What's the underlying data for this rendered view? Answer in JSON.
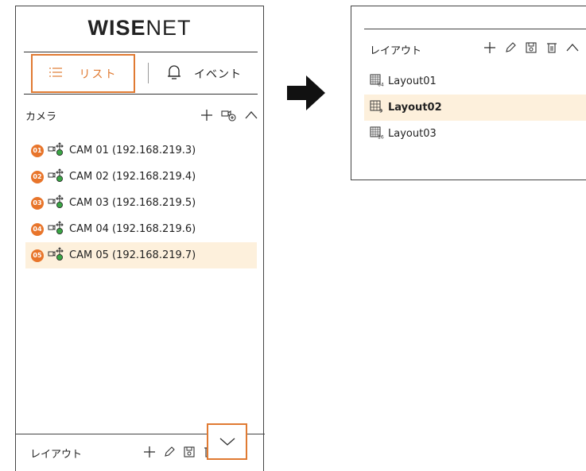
{
  "brand": {
    "logo_bold": "WISE",
    "logo_thin": "NET"
  },
  "tabs": [
    {
      "label": "リスト",
      "icon": "list-icon",
      "active": true
    },
    {
      "label": "イベント",
      "icon": "bell-icon",
      "active": false
    }
  ],
  "camera_section": {
    "title": "カメラ",
    "tools": [
      "add-icon",
      "camera-add-icon",
      "chevron-up-icon"
    ],
    "cameras": [
      {
        "badge": "01",
        "label": "CAM 01 (192.168.219.3)",
        "selected": false
      },
      {
        "badge": "02",
        "label": "CAM 02 (192.168.219.4)",
        "selected": false
      },
      {
        "badge": "03",
        "label": "CAM 03 (192.168.219.5)",
        "selected": false
      },
      {
        "badge": "04",
        "label": "CAM 04 (192.168.219.6)",
        "selected": false
      },
      {
        "badge": "05",
        "label": "CAM 05 (192.168.219.7)",
        "selected": true
      }
    ]
  },
  "layout_section_collapsed": {
    "title": "レイアウト",
    "tools": [
      "add-icon",
      "edit-icon",
      "save-icon",
      "delete-icon",
      "chevron-down-icon"
    ]
  },
  "layout_section_expanded": {
    "title": "レイアウト",
    "tools": [
      "add-icon",
      "edit-icon",
      "save-icon",
      "delete-icon",
      "chevron-up-icon"
    ],
    "layouts": [
      {
        "label": "Layout01",
        "icon_num": "64",
        "selected": false
      },
      {
        "label": "Layout02",
        "icon_num": "9",
        "selected": true
      },
      {
        "label": "Layout03",
        "icon_num": "16",
        "selected": false
      }
    ]
  },
  "colors": {
    "accent": "#e07a32",
    "badge": "#e8752b",
    "selected_row": "#fdf0dc"
  }
}
